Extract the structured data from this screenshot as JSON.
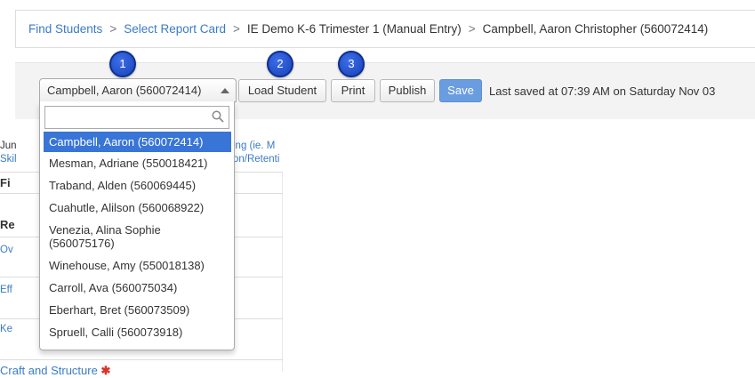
{
  "breadcrumb": {
    "items": [
      {
        "label": "Find Students",
        "link": true
      },
      {
        "label": "Select Report Card",
        "link": true
      },
      {
        "label": "IE Demo K-6 Trimester 1 (Manual Entry)",
        "link": false
      },
      {
        "label": "Campbell, Aaron Christopher (560072414)",
        "link": false
      }
    ],
    "separator": ">"
  },
  "toolbar": {
    "selected_student": "Campbell, Aaron (560072414)",
    "load_label": "Load Student",
    "print_label": "Print",
    "publish_label": "Publish",
    "save_label": "Save",
    "last_saved": "Last saved at 07:39 AM on Saturday Nov 03"
  },
  "badges": [
    "1",
    "2",
    "3"
  ],
  "dropdown": {
    "search_placeholder": "",
    "options": [
      {
        "label": "Campbell, Aaron (560072414)",
        "selected": true
      },
      {
        "label": "Mesman, Adriane (550018421)",
        "selected": false
      },
      {
        "label": "Traband, Alden (560069445)",
        "selected": false
      },
      {
        "label": "Cuahutle, Alilson (560068922)",
        "selected": false
      },
      {
        "label": "Venezia, Alina Sophie\n(560075176)",
        "selected": false
      },
      {
        "label": "Winehouse, Amy (550018138)",
        "selected": false
      },
      {
        "label": "Carroll, Ava (560075034)",
        "selected": false
      },
      {
        "label": "Eberhart, Bret (560073509)",
        "selected": false
      },
      {
        "label": "Spruell, Calli (560073918)",
        "selected": false
      }
    ]
  },
  "background": {
    "line1_left": "Jun",
    "line1_right": "ing (ie. M",
    "line2_left": "Skil",
    "line2_right": "on/Retenti",
    "header_frag": "Fi",
    "section_frag": "Re",
    "link_frags": [
      "Ov",
      "Eff",
      "Ke"
    ],
    "bottom_link": "Craft and Structure",
    "required_mark": "✱"
  },
  "colors": {
    "link": "#3a7bc8",
    "save_button": "#6a9de0",
    "selected_option": "#3875d7",
    "badge": "#1f4fd0",
    "required": "#d9342b"
  }
}
